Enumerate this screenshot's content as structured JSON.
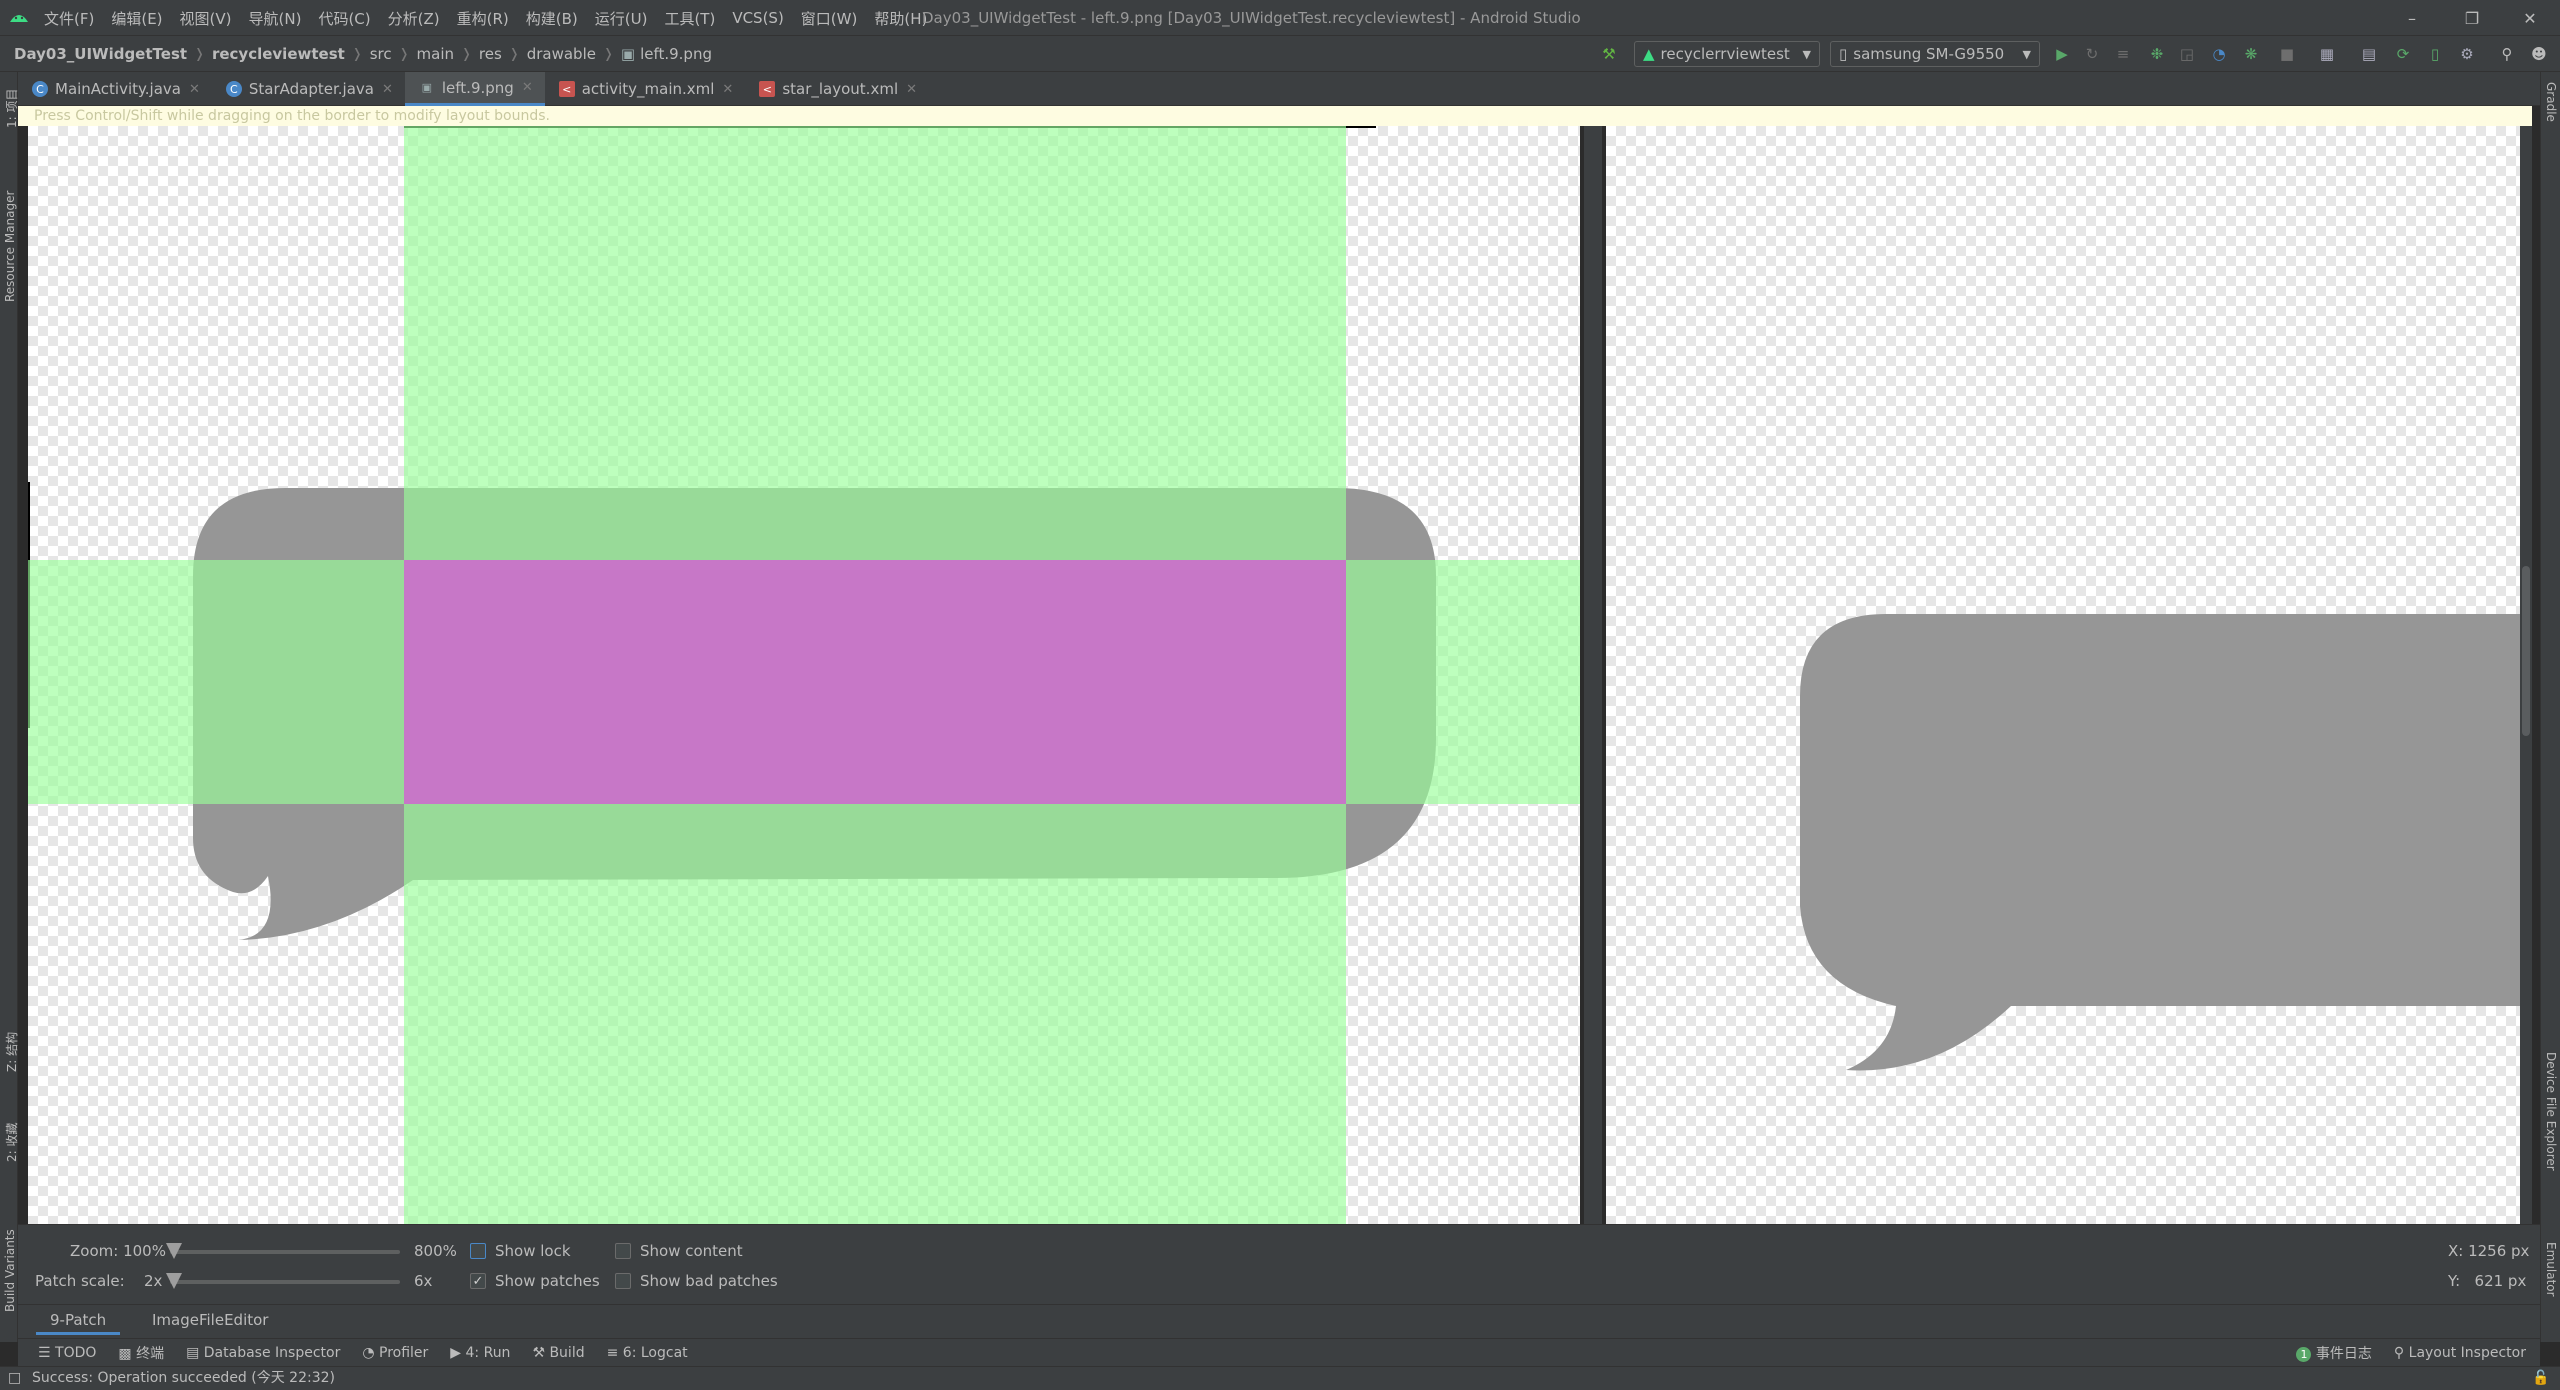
{
  "menu": [
    "文件(F)",
    "编辑(E)",
    "视图(V)",
    "导航(N)",
    "代码(C)",
    "分析(Z)",
    "重构(R)",
    "构建(B)",
    "运行(U)",
    "工具(T)",
    "VCS(S)",
    "窗口(W)",
    "帮助(H)"
  ],
  "window_title": "Day03_UIWidgetTest - left.9.png [Day03_UIWidgetTest.recycleviewtest] - Android Studio",
  "breadcrumbs": [
    "Day03_UIWidgetTest",
    "recycleviewtest",
    "src",
    "main",
    "res",
    "drawable",
    "left.9.png"
  ],
  "run_config": "recyclerrviewtest",
  "device": "samsung SM-G9550",
  "tabs": [
    {
      "label": "MainActivity.java",
      "icon": "c"
    },
    {
      "label": "StarAdapter.java",
      "icon": "c"
    },
    {
      "label": "left.9.png",
      "icon": "img",
      "active": true
    },
    {
      "label": "activity_main.xml",
      "icon": "xml"
    },
    {
      "label": "star_layout.xml",
      "icon": "xml"
    }
  ],
  "hint": "Press Control/Shift while dragging on the border to modify layout bounds.",
  "left_strip": [
    "1: 项目",
    "Resource Manager",
    "Z: 结构",
    "2: 收藏",
    "Build Variants"
  ],
  "right_strip": [
    "Gradle",
    "Device File Explorer",
    "Emulator"
  ],
  "controls": {
    "zoom_label": "Zoom: 100%",
    "zoom_max": "800%",
    "patch_label": "Patch scale:",
    "patch_min": "2x",
    "patch_max": "6x",
    "show_lock": "Show lock",
    "show_patches": "Show patches",
    "show_content": "Show content",
    "show_bad_patches": "Show bad patches",
    "coord_x": "X: 1256 px",
    "coord_y": "Y:   621 px"
  },
  "sub_tabs": [
    "9-Patch",
    "ImageFileEditor"
  ],
  "tool_windows": [
    "TODO",
    "终端",
    "Database Inspector",
    "Profiler",
    "4: Run",
    "Build",
    "6: Logcat"
  ],
  "tool_windows_right": [
    "事件日志",
    "Layout Inspector"
  ],
  "event_count": "1",
  "status": "Success: Operation succeeded (今天 22:32)",
  "colors": {
    "patch_green": "#99ff99",
    "patch_magenta": "#c777c7",
    "bubble_gray": "#969696",
    "accent": "#4a88c7"
  }
}
